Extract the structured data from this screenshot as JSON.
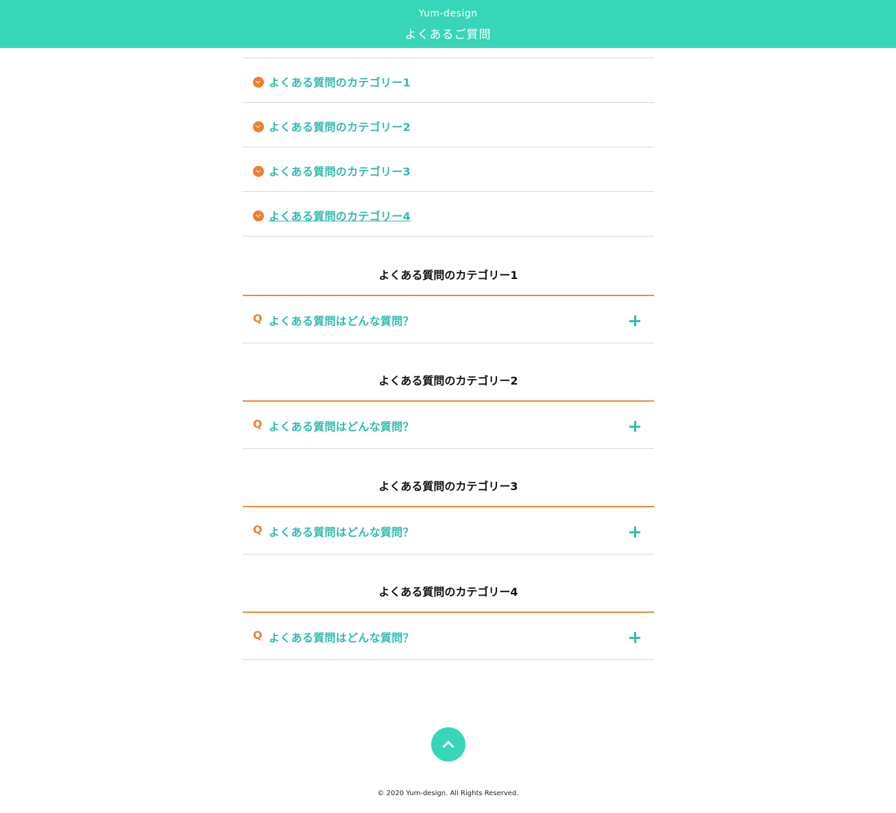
{
  "header": {
    "site_name": "Yum-design",
    "page_title": "よくあるご質問"
  },
  "category_nav": {
    "items": [
      {
        "label": "よくある質問のカテゴリー1"
      },
      {
        "label": "よくある質問のカテゴリー2"
      },
      {
        "label": "よくある質問のカテゴリー3"
      },
      {
        "label": "よくある質問のカテゴリー4"
      }
    ]
  },
  "sections": [
    {
      "heading": "よくある質問のカテゴリー1",
      "q_mark": "Q",
      "question": "よくある質問はどんな質問？"
    },
    {
      "heading": "よくある質問のカテゴリー2",
      "q_mark": "Q",
      "question": "よくある質問はどんな質問？"
    },
    {
      "heading": "よくある質問のカテゴリー3",
      "q_mark": "Q",
      "question": "よくある質問はどんな質問？"
    },
    {
      "heading": "よくある質問のカテゴリー4",
      "q_mark": "Q",
      "question": "よくある質問はどんな質問？"
    }
  ],
  "footer": {
    "copyright": "© 2020 Yum-design. All Rights Reserved."
  },
  "colors": {
    "brand": "#38d6b8",
    "link_text": "#2ebbb0",
    "accent": "#ef7f2b"
  },
  "icons": {
    "category_bullet": "chevron-down-icon",
    "expand": "plus-icon",
    "back_to_top": "chevron-up-icon"
  }
}
